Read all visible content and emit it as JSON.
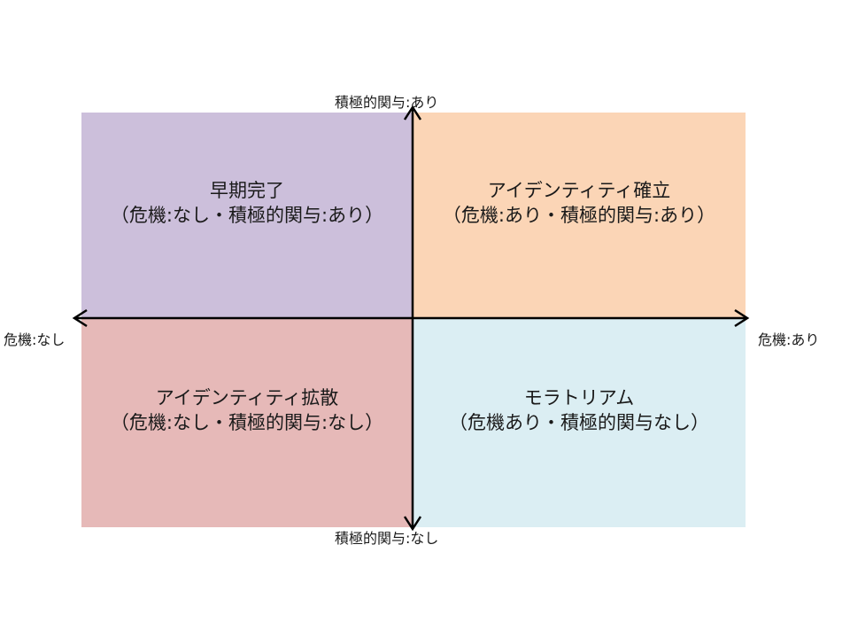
{
  "colors": {
    "top_left": "#ccbfdb",
    "top_right": "#fbd5b6",
    "bottom_left": "#e6b9b8",
    "bottom_right": "#dbeef3",
    "axis": "#000000"
  },
  "quadrants": {
    "top_left": {
      "title": "早期完了",
      "sub": "（危機:なし・積極的関与:あり）"
    },
    "top_right": {
      "title": "アイデンティティ確立",
      "sub": "（危機:あり・積極的関与:あり）"
    },
    "bottom_left": {
      "title": "アイデンティティ拡散",
      "sub": "（危機:なし・積極的関与:なし）"
    },
    "bottom_right": {
      "title": "モラトリアム",
      "sub": "（危機あり・積極的関与なし）"
    }
  },
  "axes": {
    "top": "積極的関与:あり",
    "bottom": "積極的関与:なし",
    "left": "危機:なし",
    "right": "危機:あり"
  }
}
